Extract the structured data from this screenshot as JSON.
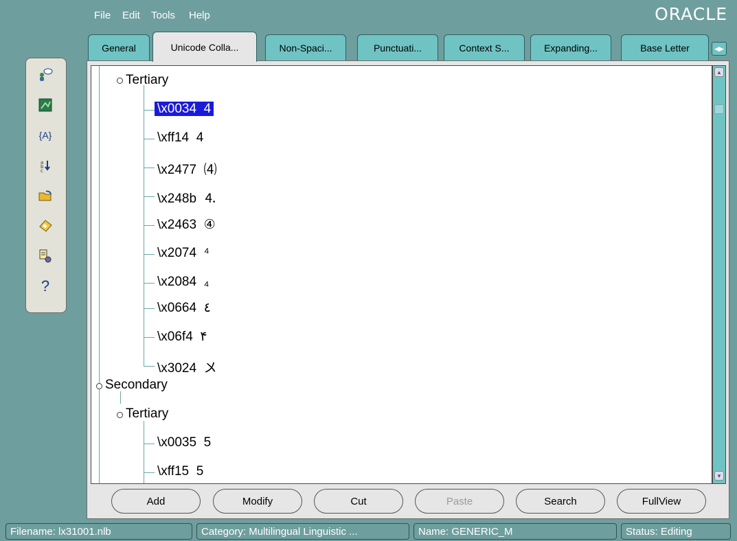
{
  "menu": {
    "file": "File",
    "edit": "Edit",
    "tools": "Tools",
    "help": "Help"
  },
  "brand": "ORACLE",
  "tabs": [
    {
      "label": "General"
    },
    {
      "label": "Unicode Colla..."
    },
    {
      "label": "Non-Spaci..."
    },
    {
      "label": "Punctuati..."
    },
    {
      "label": "Context S..."
    },
    {
      "label": "Expanding..."
    },
    {
      "label": "Base Letter"
    }
  ],
  "toolbar_icons": [
    "user-chat-icon",
    "map-icon",
    "variable-braces-icon",
    "sort-icon",
    "open-folder-icon",
    "save-icon",
    "settings-document-icon",
    "help-icon"
  ],
  "tree": {
    "tertiary1": "Tertiary",
    "entries1": [
      {
        "code": "\\x0034",
        "char": "4"
      },
      {
        "code": "\\xff14",
        "char": "4"
      },
      {
        "code": "\\x2477",
        "char": "⑷"
      },
      {
        "code": "\\x248b",
        "char": "⒋"
      },
      {
        "code": "\\x2463",
        "char": "④"
      },
      {
        "code": "\\x2074",
        "char": "⁴"
      },
      {
        "code": "\\x2084",
        "char": "₄"
      },
      {
        "code": "\\x0664",
        "char": "٤"
      },
      {
        "code": "\\x06f4",
        "char": "۴"
      },
      {
        "code": "\\x3024",
        "char": "〤"
      }
    ],
    "secondary": "Secondary",
    "tertiary2": "Tertiary",
    "entries2": [
      {
        "code": "\\x0035",
        "char": "5"
      },
      {
        "code": "\\xff15",
        "char": "5"
      }
    ]
  },
  "buttons": {
    "add": "Add",
    "modify": "Modify",
    "cut": "Cut",
    "paste": "Paste",
    "search": "Search",
    "fullview": "FullView"
  },
  "status": {
    "filename": "Filename: lx31001.nlb",
    "category": "Category: Multilingual Linguistic ...",
    "name": "Name: GENERIC_M",
    "state": "Status: Editing"
  },
  "colors": {
    "background": "#6f9e9e",
    "tab": "#6fc3c3",
    "selection": "#1a1adb",
    "panel": "#e6e6e6"
  }
}
